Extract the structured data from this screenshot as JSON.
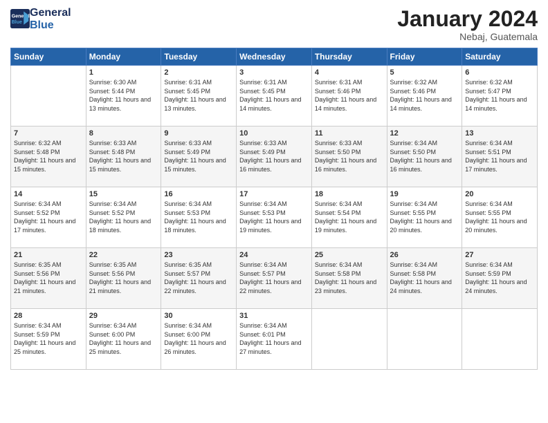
{
  "header": {
    "logo_line1": "General",
    "logo_line2": "Blue",
    "month_title": "January 2024",
    "location": "Nebaj, Guatemala"
  },
  "weekdays": [
    "Sunday",
    "Monday",
    "Tuesday",
    "Wednesday",
    "Thursday",
    "Friday",
    "Saturday"
  ],
  "weeks": [
    [
      {
        "day": "",
        "sunrise": "",
        "sunset": "",
        "daylight": ""
      },
      {
        "day": "1",
        "sunrise": "6:30 AM",
        "sunset": "5:44 PM",
        "daylight": "11 hours and 13 minutes."
      },
      {
        "day": "2",
        "sunrise": "6:31 AM",
        "sunset": "5:45 PM",
        "daylight": "11 hours and 13 minutes."
      },
      {
        "day": "3",
        "sunrise": "6:31 AM",
        "sunset": "5:45 PM",
        "daylight": "11 hours and 14 minutes."
      },
      {
        "day": "4",
        "sunrise": "6:31 AM",
        "sunset": "5:46 PM",
        "daylight": "11 hours and 14 minutes."
      },
      {
        "day": "5",
        "sunrise": "6:32 AM",
        "sunset": "5:46 PM",
        "daylight": "11 hours and 14 minutes."
      },
      {
        "day": "6",
        "sunrise": "6:32 AM",
        "sunset": "5:47 PM",
        "daylight": "11 hours and 14 minutes."
      }
    ],
    [
      {
        "day": "7",
        "sunrise": "6:32 AM",
        "sunset": "5:48 PM",
        "daylight": "11 hours and 15 minutes."
      },
      {
        "day": "8",
        "sunrise": "6:33 AM",
        "sunset": "5:48 PM",
        "daylight": "11 hours and 15 minutes."
      },
      {
        "day": "9",
        "sunrise": "6:33 AM",
        "sunset": "5:49 PM",
        "daylight": "11 hours and 15 minutes."
      },
      {
        "day": "10",
        "sunrise": "6:33 AM",
        "sunset": "5:49 PM",
        "daylight": "11 hours and 16 minutes."
      },
      {
        "day": "11",
        "sunrise": "6:33 AM",
        "sunset": "5:50 PM",
        "daylight": "11 hours and 16 minutes."
      },
      {
        "day": "12",
        "sunrise": "6:34 AM",
        "sunset": "5:50 PM",
        "daylight": "11 hours and 16 minutes."
      },
      {
        "day": "13",
        "sunrise": "6:34 AM",
        "sunset": "5:51 PM",
        "daylight": "11 hours and 17 minutes."
      }
    ],
    [
      {
        "day": "14",
        "sunrise": "6:34 AM",
        "sunset": "5:52 PM",
        "daylight": "11 hours and 17 minutes."
      },
      {
        "day": "15",
        "sunrise": "6:34 AM",
        "sunset": "5:52 PM",
        "daylight": "11 hours and 18 minutes."
      },
      {
        "day": "16",
        "sunrise": "6:34 AM",
        "sunset": "5:53 PM",
        "daylight": "11 hours and 18 minutes."
      },
      {
        "day": "17",
        "sunrise": "6:34 AM",
        "sunset": "5:53 PM",
        "daylight": "11 hours and 19 minutes."
      },
      {
        "day": "18",
        "sunrise": "6:34 AM",
        "sunset": "5:54 PM",
        "daylight": "11 hours and 19 minutes."
      },
      {
        "day": "19",
        "sunrise": "6:34 AM",
        "sunset": "5:55 PM",
        "daylight": "11 hours and 20 minutes."
      },
      {
        "day": "20",
        "sunrise": "6:34 AM",
        "sunset": "5:55 PM",
        "daylight": "11 hours and 20 minutes."
      }
    ],
    [
      {
        "day": "21",
        "sunrise": "6:35 AM",
        "sunset": "5:56 PM",
        "daylight": "11 hours and 21 minutes."
      },
      {
        "day": "22",
        "sunrise": "6:35 AM",
        "sunset": "5:56 PM",
        "daylight": "11 hours and 21 minutes."
      },
      {
        "day": "23",
        "sunrise": "6:35 AM",
        "sunset": "5:57 PM",
        "daylight": "11 hours and 22 minutes."
      },
      {
        "day": "24",
        "sunrise": "6:34 AM",
        "sunset": "5:57 PM",
        "daylight": "11 hours and 22 minutes."
      },
      {
        "day": "25",
        "sunrise": "6:34 AM",
        "sunset": "5:58 PM",
        "daylight": "11 hours and 23 minutes."
      },
      {
        "day": "26",
        "sunrise": "6:34 AM",
        "sunset": "5:58 PM",
        "daylight": "11 hours and 24 minutes."
      },
      {
        "day": "27",
        "sunrise": "6:34 AM",
        "sunset": "5:59 PM",
        "daylight": "11 hours and 24 minutes."
      }
    ],
    [
      {
        "day": "28",
        "sunrise": "6:34 AM",
        "sunset": "5:59 PM",
        "daylight": "11 hours and 25 minutes."
      },
      {
        "day": "29",
        "sunrise": "6:34 AM",
        "sunset": "6:00 PM",
        "daylight": "11 hours and 25 minutes."
      },
      {
        "day": "30",
        "sunrise": "6:34 AM",
        "sunset": "6:00 PM",
        "daylight": "11 hours and 26 minutes."
      },
      {
        "day": "31",
        "sunrise": "6:34 AM",
        "sunset": "6:01 PM",
        "daylight": "11 hours and 27 minutes."
      },
      {
        "day": "",
        "sunrise": "",
        "sunset": "",
        "daylight": ""
      },
      {
        "day": "",
        "sunrise": "",
        "sunset": "",
        "daylight": ""
      },
      {
        "day": "",
        "sunrise": "",
        "sunset": "",
        "daylight": ""
      }
    ]
  ]
}
